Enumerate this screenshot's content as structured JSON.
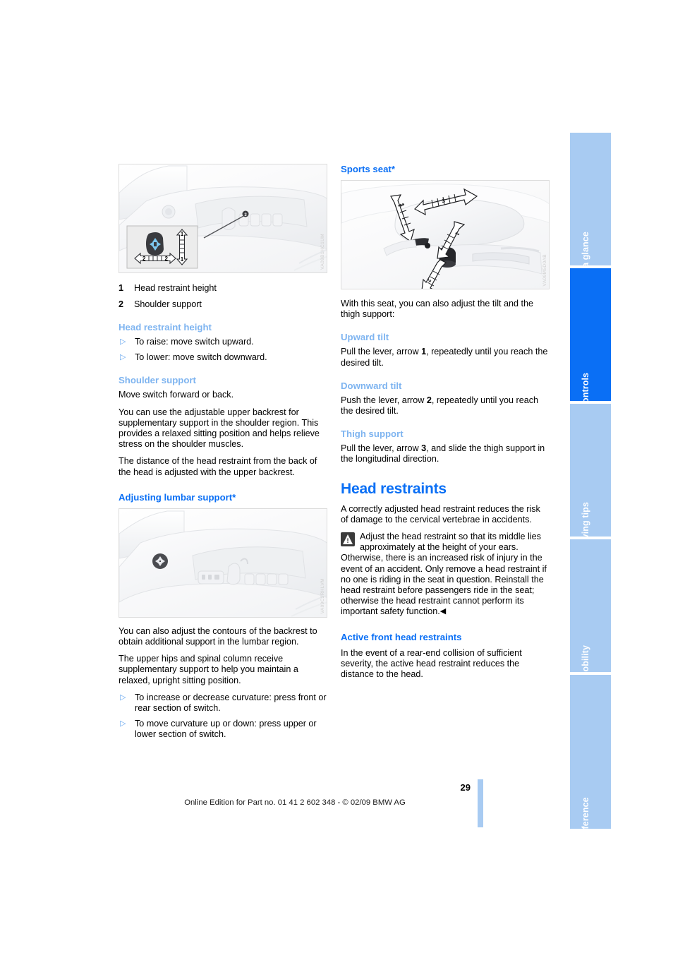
{
  "document": {
    "page_number": "29",
    "footer_text": "Online Edition for Part no. 01 41 2 602 348 - © 02/09 BMW AG"
  },
  "colors": {
    "heading_blue": "#0a6ff5",
    "subheading_light_blue": "#7eb4f0",
    "tab_inactive": "#a8cbf2",
    "tab_active": "#0a6ff5"
  },
  "sidebar": {
    "tabs": [
      {
        "label": "At a glance",
        "active": false
      },
      {
        "label": "Controls",
        "active": true
      },
      {
        "label": "Driving tips",
        "active": false
      },
      {
        "label": "Mobility",
        "active": false
      },
      {
        "label": "Reference",
        "active": false
      }
    ]
  },
  "left_column": {
    "figure_seat_switch": {
      "name": "seat-adjustment-switch-illustration",
      "image_code": "VA09B1HC1UM",
      "callouts": [
        "1",
        "2"
      ]
    },
    "legend": [
      {
        "num": "1",
        "text": "Head restraint height"
      },
      {
        "num": "2",
        "text": "Shoulder support"
      }
    ],
    "head_restraint_height": {
      "heading": "Head restraint height",
      "bullets": [
        "To raise: move switch upward.",
        "To lower: move switch downward."
      ]
    },
    "shoulder_support": {
      "heading": "Shoulder support",
      "paragraphs": [
        "Move switch forward or back.",
        "You can use the adjustable upper backrest for supplementary support in the shoulder region. This provides a relaxed sitting position and helps relieve stress on the shoulder muscles.",
        "The distance of the head restraint from the back of the head is adjusted with the upper backrest."
      ]
    },
    "lumbar_support": {
      "heading": "Adjusting lumbar support*",
      "figure": {
        "name": "lumbar-support-switch-illustration",
        "image_code": "VA09C2RHLVM"
      },
      "paragraphs": [
        "You can also adjust the contours of the backrest to obtain additional support in the lumbar region.",
        "The upper hips and spinal column receive supplementary support to help you maintain a relaxed, upright sitting position."
      ],
      "bullets": [
        "To increase or decrease curvature: press front or rear section of switch.",
        "To move curvature up or down: press upper or lower section of switch."
      ]
    }
  },
  "right_column": {
    "sports_seat": {
      "heading": "Sports seat*",
      "figure": {
        "name": "sports-seat-lever-illustration",
        "image_code": "VA09M5D0AB",
        "callouts": [
          "1",
          "2",
          "3"
        ]
      },
      "intro": "With this seat, you can also adjust the tilt and the thigh support:",
      "upward_tilt": {
        "heading": "Upward tilt",
        "text_before": "Pull the lever, arrow ",
        "arrow": "1",
        "text_after": ", repeatedly until you reach the desired tilt."
      },
      "downward_tilt": {
        "heading": "Downward tilt",
        "text_before": "Push the lever, arrow ",
        "arrow": "2",
        "text_after": ", repeatedly until you reach the desired tilt."
      },
      "thigh_support": {
        "heading": "Thigh support",
        "text_before": "Pull the lever, arrow ",
        "arrow": "3",
        "text_after": ", and slide the thigh support in the longitudinal direction."
      }
    },
    "head_restraints": {
      "heading": "Head restraints",
      "intro": "A correctly adjusted head restraint reduces the risk of damage to the cervical vertebrae in accidents.",
      "warning": {
        "icon": "warning-triangle-icon",
        "text": "Adjust the head restraint so that its middle lies approximately at the height of your ears. Otherwise, there is an increased risk of injury in the event of an accident. Only remove a head restraint if no one is riding in the seat in question. Reinstall the head restraint before passengers ride in the seat; otherwise the head restraint cannot perform its important safety function.",
        "end_marker": "◀"
      },
      "active_front": {
        "heading": "Active front head restraints",
        "text": "In the event of a rear-end collision of sufficient severity, the active head restraint reduces the distance to the head."
      }
    }
  }
}
